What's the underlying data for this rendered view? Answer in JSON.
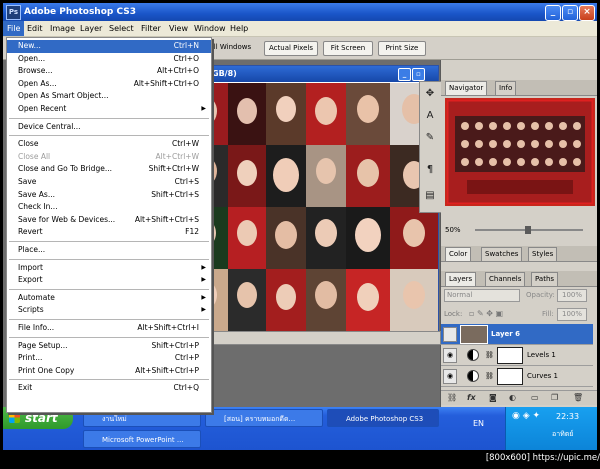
{
  "window": {
    "title": "Adobe Photoshop CS3",
    "app_icon_text": "Ps",
    "minimize_label": "_",
    "maximize_label": "▫",
    "close_label": "×"
  },
  "menubar": [
    "File",
    "Edit",
    "Image",
    "Layer",
    "Select",
    "Filter",
    "View",
    "Window",
    "Help"
  ],
  "options_bar": {
    "all_windows_label": "All Windows",
    "buttons": [
      "Actual Pixels",
      "Fit Screen",
      "Print Size"
    ]
  },
  "document": {
    "title_fragment": "GB/8)",
    "min_label": "_",
    "max_label": "▫"
  },
  "file_menu": {
    "items": [
      {
        "label": "New...",
        "shortcut": "Ctrl+N",
        "state": "highlighted"
      },
      {
        "label": "Open...",
        "shortcut": "Ctrl+O"
      },
      {
        "label": "Browse...",
        "shortcut": "Alt+Ctrl+O"
      },
      {
        "label": "Open As...",
        "shortcut": "Alt+Shift+Ctrl+O"
      },
      {
        "label": "Open As Smart Object...",
        "shortcut": ""
      },
      {
        "label": "Open Recent",
        "shortcut": "",
        "submenu": true
      },
      {
        "sep": true
      },
      {
        "label": "Device Central...",
        "shortcut": ""
      },
      {
        "sep": true
      },
      {
        "label": "Close",
        "shortcut": "Ctrl+W"
      },
      {
        "label": "Close All",
        "shortcut": "Alt+Ctrl+W",
        "state": "disabled"
      },
      {
        "label": "Close and Go To Bridge...",
        "shortcut": "Shift+Ctrl+W"
      },
      {
        "label": "Save",
        "shortcut": "Ctrl+S"
      },
      {
        "label": "Save As...",
        "shortcut": "Shift+Ctrl+S"
      },
      {
        "label": "Check In...",
        "shortcut": ""
      },
      {
        "label": "Save for Web & Devices...",
        "shortcut": "Alt+Shift+Ctrl+S"
      },
      {
        "label": "Revert",
        "shortcut": "F12"
      },
      {
        "sep": true
      },
      {
        "label": "Place...",
        "shortcut": ""
      },
      {
        "sep": true
      },
      {
        "label": "Import",
        "shortcut": "",
        "submenu": true
      },
      {
        "label": "Export",
        "shortcut": "",
        "submenu": true
      },
      {
        "sep": true
      },
      {
        "label": "Automate",
        "shortcut": "",
        "submenu": true
      },
      {
        "label": "Scripts",
        "shortcut": "",
        "submenu": true
      },
      {
        "sep": true
      },
      {
        "label": "File Info...",
        "shortcut": "Alt+Shift+Ctrl+I"
      },
      {
        "sep": true
      },
      {
        "label": "Page Setup...",
        "shortcut": "Shift+Ctrl+P"
      },
      {
        "label": "Print...",
        "shortcut": "Ctrl+P"
      },
      {
        "label": "Print One Copy",
        "shortcut": "Alt+Shift+Ctrl+P"
      },
      {
        "sep": true
      },
      {
        "label": "Exit",
        "shortcut": "Ctrl+Q"
      }
    ]
  },
  "navigator": {
    "tabs": [
      "Navigator",
      "Info"
    ],
    "zoom": "50%",
    "zoom_value": 0.5
  },
  "color_panel": {
    "tabs": [
      "Color",
      "Swatches",
      "Styles"
    ]
  },
  "layers_panel": {
    "tabs": [
      "Layers",
      "Channels",
      "Paths"
    ],
    "blend_mode": "Normal",
    "opacity_label": "Opacity:",
    "opacity": "100%",
    "lock_label": "Lock:",
    "fill_label": "Fill:",
    "fill": "100%",
    "layers": [
      {
        "name": "Layer 6",
        "selected": true
      },
      {
        "name": "Levels 1",
        "selected": false
      },
      {
        "name": "Curves 1",
        "selected": false
      }
    ],
    "footer_icons": [
      "link-icon",
      "fx-icon",
      "mask-icon",
      "adjustment-icon",
      "group-icon",
      "new-layer-icon",
      "trash-icon"
    ]
  },
  "taskbar": {
    "start_label": "start",
    "items_row1": [
      "งานใหม่",
      "[สอน] คราบหมอกดีด...",
      "Adobe Photoshop CS3"
    ],
    "items_row2": [
      "Microsoft PowerPoint ..."
    ],
    "lang": "EN",
    "time": "22:33",
    "day": "อาทิตย์"
  },
  "watermark": "[800x600] https://upic.me/",
  "colors": {
    "titlebar": "#1a55c8",
    "menu_highlight": "#316ac5",
    "taskbar": "#245edb",
    "start_green": "#2f9a2a"
  }
}
